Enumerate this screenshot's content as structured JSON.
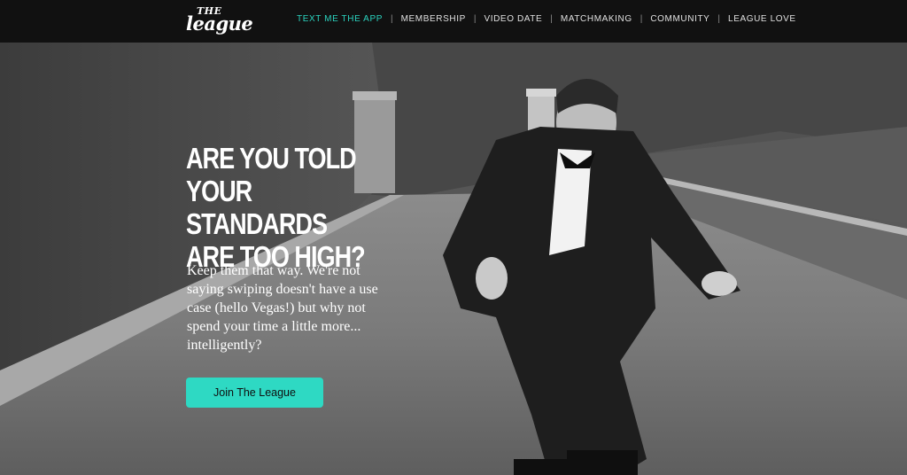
{
  "brand": {
    "logo_top": "THE",
    "logo_bottom": "league"
  },
  "nav": {
    "items": [
      {
        "label": "TEXT ME THE APP",
        "active": true
      },
      {
        "label": "MEMBERSHIP",
        "active": false
      },
      {
        "label": "VIDEO DATE",
        "active": false
      },
      {
        "label": "MATCHMAKING",
        "active": false
      },
      {
        "label": "COMMUNITY",
        "active": false
      },
      {
        "label": "LEAGUE LOVE",
        "active": false
      }
    ],
    "separator": "|"
  },
  "hero": {
    "headline_line1": "ARE YOU TOLD",
    "headline_line2": "YOUR STANDARDS",
    "headline_line3": "ARE TOO HIGH?",
    "body": "Keep them that way. We're not saying swiping doesn't have a use case (hello Vegas!) but why not spend your time a little more... intelligently?",
    "cta_label": "Join The League"
  },
  "colors": {
    "nav_background": "#111111",
    "accent": "#2ed9c3",
    "active_nav": "#2bd4c0"
  }
}
